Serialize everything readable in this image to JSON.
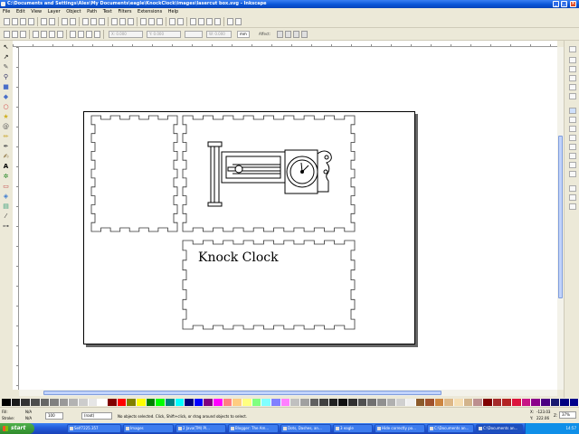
{
  "window": {
    "title": "C:\\Documents and Settings\\Alex\\My Documents\\eagle\\KnockClock\\images\\lasercut box.svg - Inkscape",
    "min_label": "_",
    "max_label": "□",
    "close_label": "×"
  },
  "menu": [
    "File",
    "Edit",
    "View",
    "Layer",
    "Object",
    "Path",
    "Text",
    "Filters",
    "Extensions",
    "Help"
  ],
  "controls": {
    "x_value": "X: 0.000",
    "y_value": "Y: 0.000",
    "w_value": "W: 0.000",
    "h_value": "H: 0.000",
    "unit": "mm",
    "affect_label": "Affect:"
  },
  "canvas": {
    "caption": "Knock Clock"
  },
  "status": {
    "fill_label": "Fill:",
    "stroke_label": "Stroke:",
    "fill_value": "N/A",
    "stroke_value": "N/A",
    "opacity": "100",
    "layer": "(root)",
    "message": "No objects selected. Click, Shift+click, or drag around objects to select.",
    "x_label": "X:",
    "y_label": "Y:",
    "x_coord": "-123.03",
    "y_coord": "222.06",
    "zoom_label": "Z:",
    "zoom": "37%"
  },
  "taskbar": {
    "start": "start",
    "tasks": [
      "Self7225.357",
      "Images",
      "2 Java(TM) Pl...",
      "Blogger: The Am...",
      "Dots, Dashes, an...",
      "3 eagle",
      "Hide correctly po...",
      "C:\\Documents an...",
      "C:\\Documents an..."
    ],
    "clock": "14:57"
  },
  "palette": [
    "#000000",
    "#1a1a1a",
    "#333333",
    "#4d4d4d",
    "#666666",
    "#808080",
    "#999999",
    "#b3b3b3",
    "#cccccc",
    "#e6e6e6",
    "#ffffff",
    "#800000",
    "#ff0000",
    "#808000",
    "#ffff00",
    "#008000",
    "#00ff00",
    "#008080",
    "#00ffff",
    "#000080",
    "#0000ff",
    "#800080",
    "#ff00ff",
    "#ff8080",
    "#ffcc80",
    "#ffff80",
    "#80ff80",
    "#80ffff",
    "#8080ff",
    "#ff80ff",
    "#c0c0c0",
    "#a0a0a0",
    "#606060",
    "#404040",
    "#202020",
    "#101010",
    "#303030",
    "#505050",
    "#707070",
    "#909090",
    "#b0b0b0",
    "#d0d0d0",
    "#f0f0f0",
    "#8b5a2b",
    "#a0522d",
    "#cd853f",
    "#deb887",
    "#f5deb3",
    "#d2b48c",
    "#bc8f8f",
    "#800000",
    "#a52a2a",
    "#b22222",
    "#dc143c",
    "#c71585",
    "#8b008b",
    "#4b0082",
    "#191970",
    "#000080",
    "#00008b"
  ]
}
